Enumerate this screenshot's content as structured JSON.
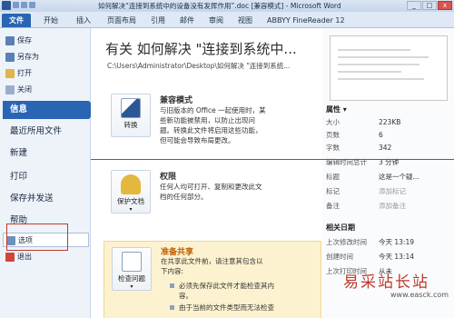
{
  "window": {
    "title": "如何解决“连接到系统中的设备没有发挥作用”.doc [兼容模式] - Microsoft Word",
    "controls": [
      "_",
      "□",
      "x"
    ]
  },
  "ribbon": {
    "tabs": [
      "文件",
      "开始",
      "插入",
      "页面布局",
      "引用",
      "邮件",
      "审阅",
      "视图",
      "ABBYY FineReader 12"
    ]
  },
  "nav": {
    "items": [
      {
        "label": "保存",
        "icon": "save-icon",
        "color": "#5a7fb5"
      },
      {
        "label": "另存为",
        "icon": "save-as-icon",
        "color": "#5a7fb5"
      },
      {
        "label": "打开",
        "icon": "folder-open-icon",
        "color": "#e0b44a"
      },
      {
        "label": "关闭",
        "icon": "close-doc-icon",
        "color": "#9aaec9"
      },
      {
        "label": "信息"
      },
      {
        "label": "最近所用文件"
      },
      {
        "label": "新建"
      },
      {
        "label": "打印"
      },
      {
        "label": "保存并发送"
      },
      {
        "label": "帮助"
      },
      {
        "label": "选项",
        "icon": "options-icon",
        "color": "#6f8fbd"
      },
      {
        "label": "退出",
        "icon": "exit-icon",
        "color": "#d0463c"
      }
    ]
  },
  "main": {
    "title": "有关 如何解决 \"连接到系统中...",
    "path": "C:\\Users\\Administrator\\Desktop\\如何解决 \"连接到系统...",
    "compat": {
      "button": "转换",
      "title": "兼容模式",
      "desc": "与旧版本的 Office 一起使用时，某些新功能被禁用，以防止出现问题。转换此文件将启用这些功能，但可能会导致布局更改。"
    },
    "permissions": {
      "button": "保护文档",
      "arrow": "▾",
      "title": "权限",
      "desc": "任何人均可打开、复制和更改此文档的任何部分。"
    },
    "share": {
      "button": "检查问题",
      "arrow": "▾",
      "title": "准备共享",
      "desc": "在共享此文件前，请注意其包含以下内容:",
      "bullets": [
        "必须先保存此文件才能检查其内容。",
        "由于当前的文件类型而无法检查"
      ]
    }
  },
  "properties": {
    "title": "属性 ▾",
    "rows": [
      {
        "k": "大小",
        "v": "223KB"
      },
      {
        "k": "页数",
        "v": "6"
      },
      {
        "k": "字数",
        "v": "342"
      },
      {
        "k": "编辑时间总计",
        "v": "3 分钟"
      },
      {
        "k": "标题",
        "v": "这是一个疑..."
      },
      {
        "k": "标记",
        "v": "添加标记"
      },
      {
        "k": "备注",
        "v": "添加备注"
      }
    ]
  },
  "dates": {
    "title": "相关日期",
    "rows": [
      {
        "k": "上次修改时间",
        "v": "今天 13:19"
      },
      {
        "k": "创建时间",
        "v": "今天 13:14"
      },
      {
        "k": "上次打印时间",
        "v": "从未"
      }
    ]
  },
  "watermark": {
    "text": "易采站长站",
    "url": "www.easck.com"
  }
}
